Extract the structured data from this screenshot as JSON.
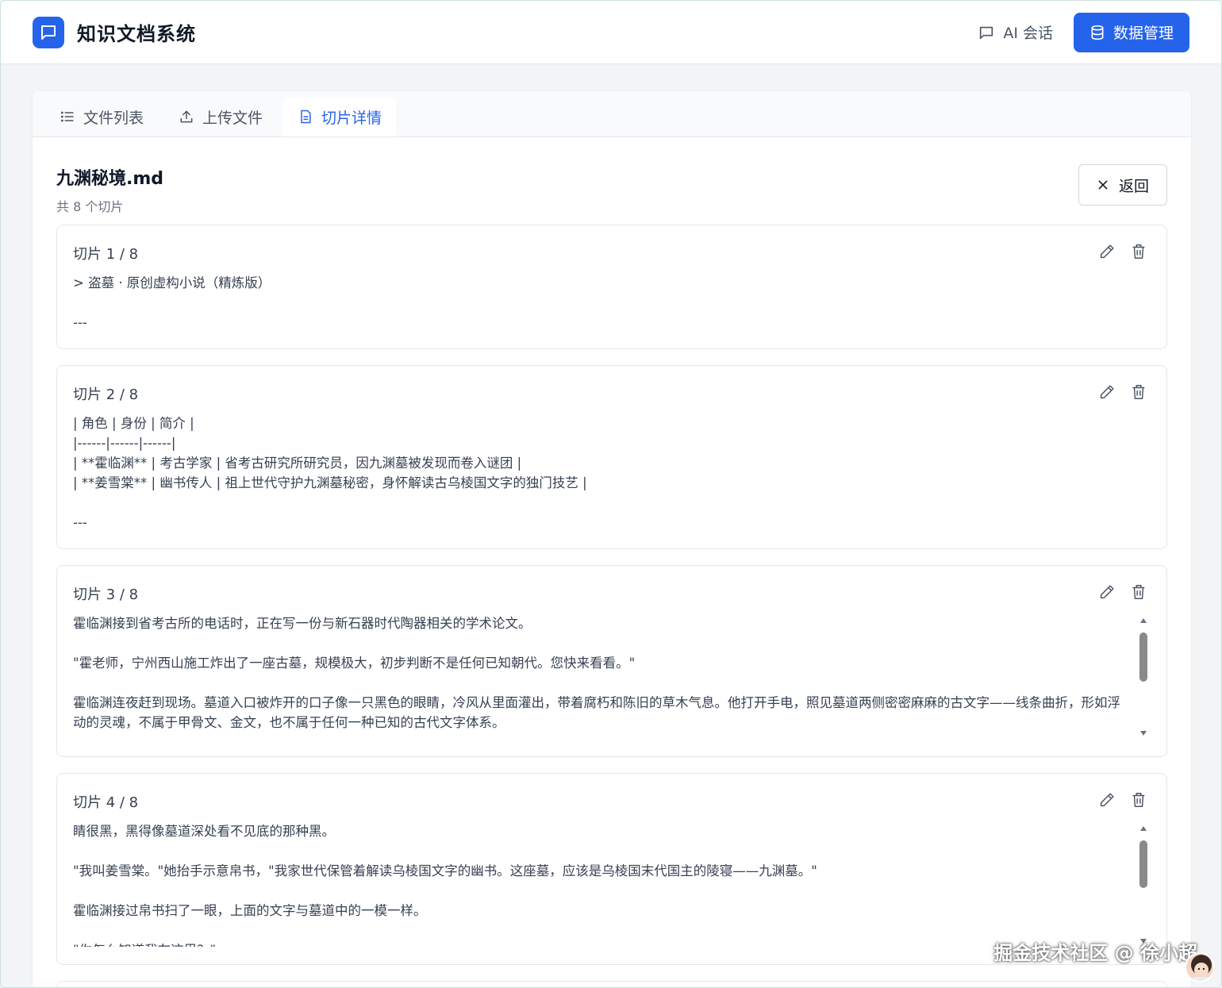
{
  "header": {
    "title": "知识文档系统",
    "ai_chat_label": "AI 会话",
    "data_mgmt_label": "数据管理",
    "accent": "#2563eb"
  },
  "tabs": [
    {
      "label": "文件列表",
      "icon": "list-icon"
    },
    {
      "label": "上传文件",
      "icon": "upload-icon"
    },
    {
      "label": "切片详情",
      "icon": "file-text-icon",
      "active": true
    }
  ],
  "file": {
    "name": "九渊秘境.md",
    "count_text": "共 8 个切片",
    "back_label": "返回"
  },
  "chunks": [
    {
      "title": "切片 1 / 8",
      "content": "> 盗墓 · 原创虚构小说（精炼版）\n\n---"
    },
    {
      "title": "切片 2 / 8",
      "content": "| 角色 | 身份 | 简介 |\n|------|------|------|\n| **霍临渊** | 考古学家 | 省考古研究所研究员，因九渊墓被发现而卷入谜团 |\n| **姜雪棠** | 幽书传人 | 祖上世代守护九渊墓秘密，身怀解读古乌棱国文字的独门技艺 |\n\n---"
    },
    {
      "title": "切片 3 / 8",
      "content": "霍临渊接到省考古所的电话时，正在写一份与新石器时代陶器相关的学术论文。\n\n\"霍老师，宁州西山施工炸出了一座古墓，规模极大，初步判断不是任何已知朝代。您快来看看。\"\n\n霍临渊连夜赶到现场。墓道入口被炸开的口子像一只黑色的眼睛，冷风从里面灌出，带着腐朽和陈旧的草木气息。他打开手电，照见墓道两侧密密麻麻的古文字——线条曲折，形如浮动的灵魂，不属于甲骨文、金文，也不属于任何一种已知的古代文字体系。"
    },
    {
      "title": "切片 4 / 8",
      "content": "睛很黑，黑得像墓道深处看不见底的那种黑。\n\n\"我叫姜雪棠。\"她抬手示意帛书，\"我家世代保管着解读乌棱国文字的幽书。这座墓，应该是乌棱国末代国主的陵寝——九渊墓。\"\n\n霍临渊接过帛书扫了一眼，上面的文字与墓道中的一模一样。\n\n\"你怎么知道我在这里？\""
    }
  ],
  "watermark": "掘金技术社区 @ 徐小超"
}
